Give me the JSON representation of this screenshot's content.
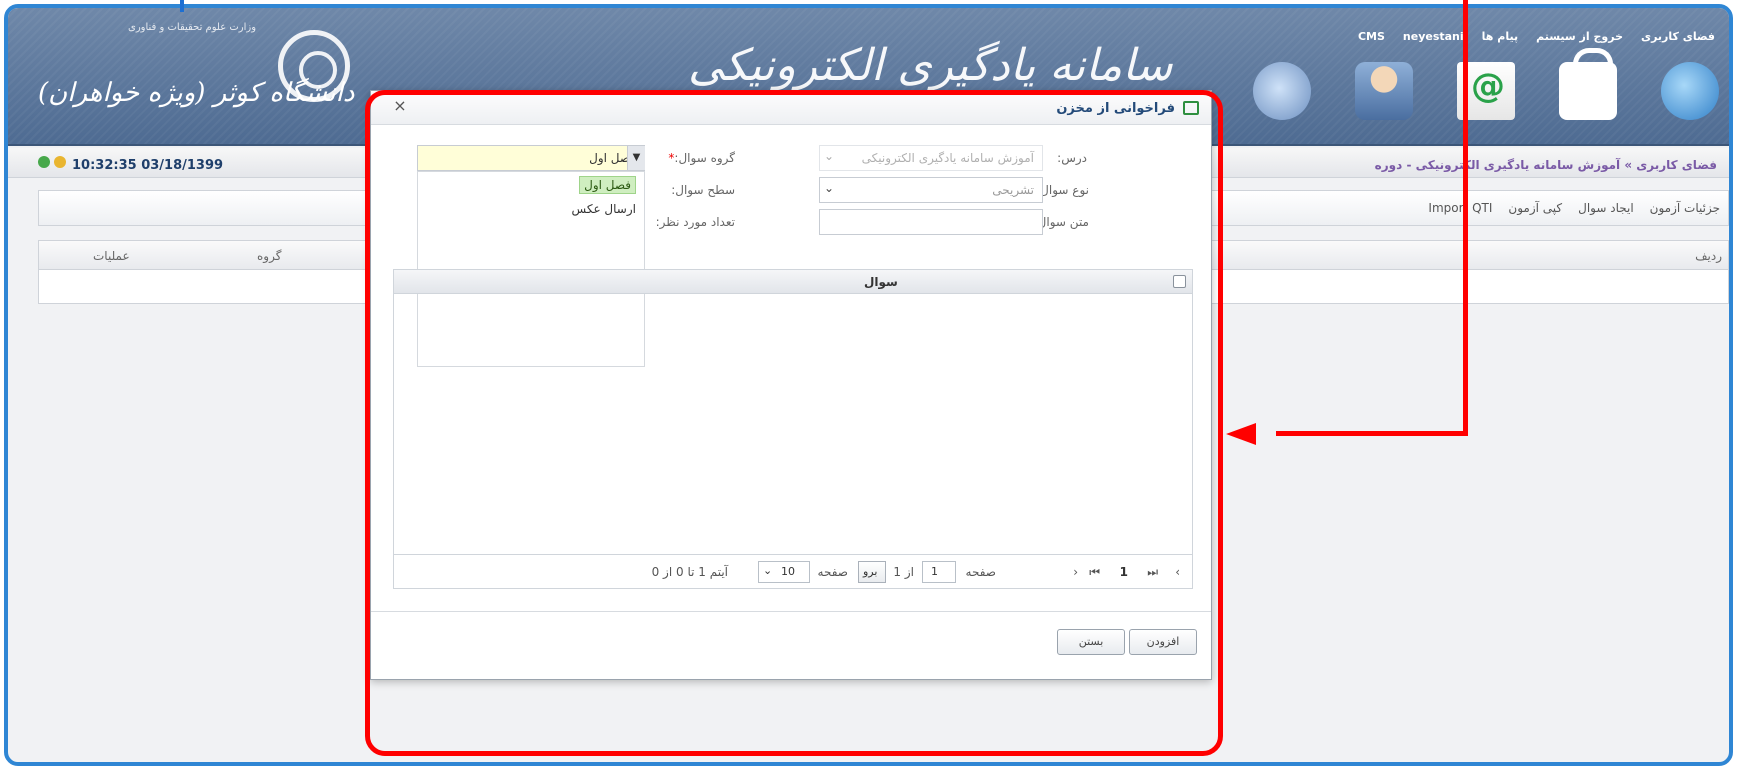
{
  "header": {
    "university_name": "دانشگاه کوثر (ویژه خواهران)",
    "university_sub": "وزارت علوم تحقیقات و فناوری",
    "calligraphy": "سامانه یادگیری الکترونیکی",
    "top_nav": [
      "فضای کاربری",
      "خروج از سیستم",
      "پیام ها",
      "neyestani",
      "CMS"
    ],
    "icons": [
      "globe-icon",
      "lock-icon",
      "mail-icon",
      "user-icon",
      "round-icon"
    ]
  },
  "status": {
    "clock": "10:32:35 03/18/1399",
    "breadcrumb": "فضای کاربری » آموزش سامانه یادگیری الکترونیکی - دوره"
  },
  "toolbar": {
    "items": [
      "جزئیات آزمون",
      "ایجاد سوال",
      "کپی آزمون",
      "Import QTI"
    ]
  },
  "grid": {
    "col_ops": "عملیات",
    "col_group": "گروه",
    "col_row": "ردیف"
  },
  "modal": {
    "title": "فراخوانی از مخزن",
    "close": "×",
    "fields": {
      "course_label": "درس:",
      "course_value": "آموزش سامانه یادگیری الکترونیکی",
      "qtype_label": "نوع سوال:",
      "qtype_value": "تشریحی",
      "qtext_label": "متن سوال:",
      "qgroup_label": "گروه سوال:",
      "qgroup_required": "*",
      "qgroup_value": "فصل اول",
      "qlevel_label": "سطح سوال:",
      "view_count_label": "تعداد مورد نظر:"
    },
    "dropdown_options": [
      "فصل اول",
      "ارسال عکس"
    ],
    "table": {
      "col_question": "سوال"
    },
    "pager": {
      "page_label": "صفحه",
      "page_value": "1",
      "of_label": "از 1",
      "go_button": "برو",
      "page_size_label": "صفحه",
      "page_size_value": "10",
      "items_info": "آیتم 1 تا 0 از 0",
      "current_page_display": "1"
    },
    "buttons": {
      "add": "افزودن",
      "close": "بستن"
    }
  },
  "colors": {
    "annotation": "#ff0000",
    "frame": "#2f86d4",
    "header": "#5a7498"
  }
}
